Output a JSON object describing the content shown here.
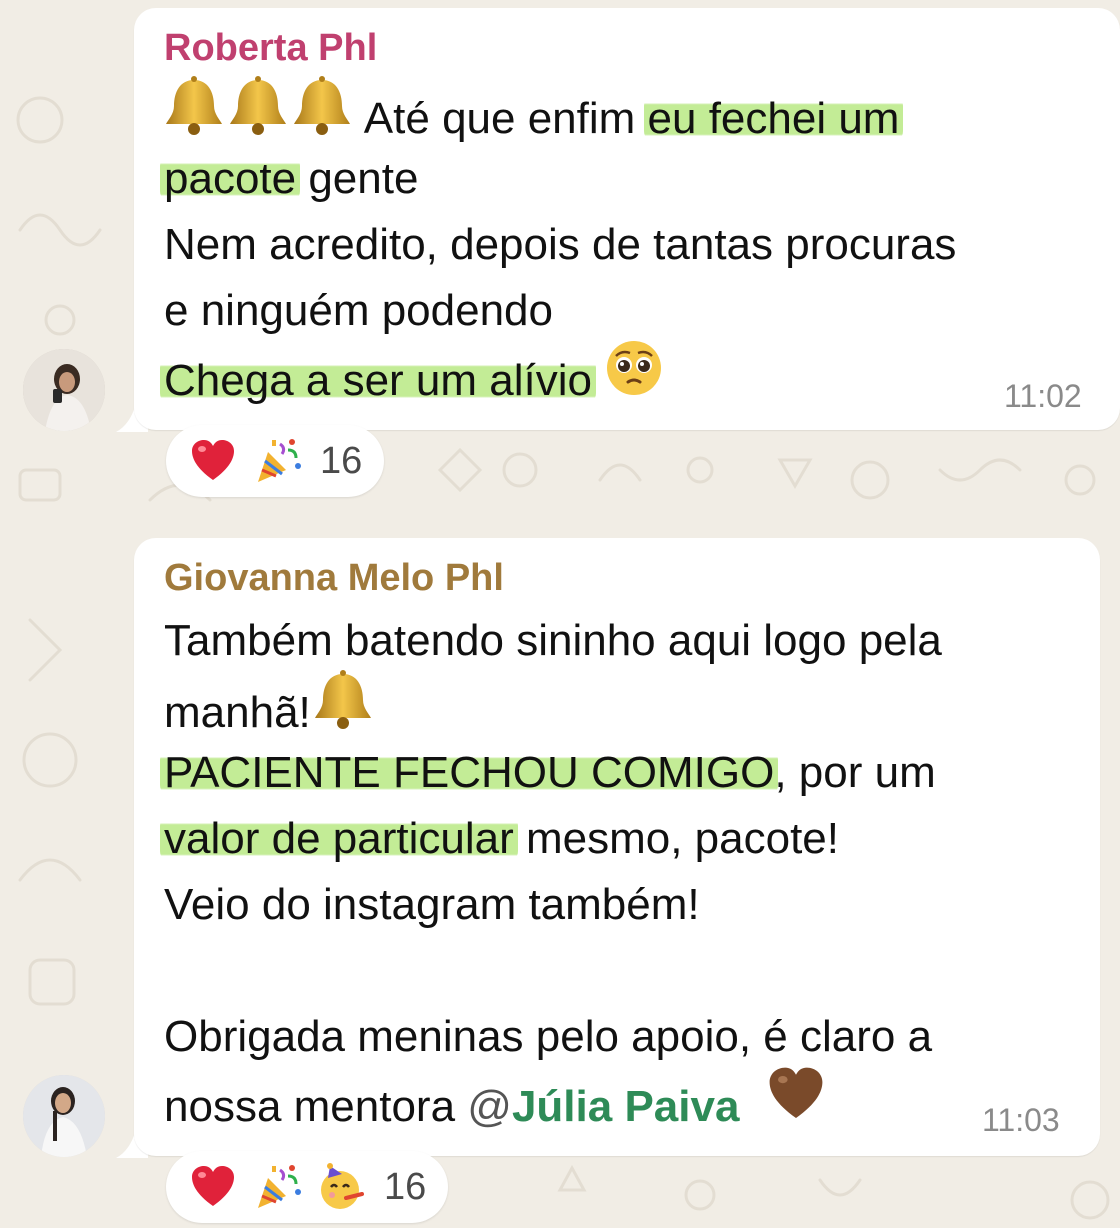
{
  "messages": [
    {
      "sender": "Roberta Phl",
      "sender_color": "#c0406f",
      "lines": [
        {
          "parts": [
            {
              "text": " Até que enfim "
            },
            {
              "text": "eu fechei um",
              "hl": true
            }
          ]
        },
        {
          "parts": [
            {
              "text": "pacote",
              "hl": true
            },
            {
              "text": " gente"
            }
          ]
        },
        {
          "parts": [
            {
              "text": "Nem acredito, depois de tantas procuras"
            }
          ]
        },
        {
          "parts": [
            {
              "text": "e ninguém podendo"
            }
          ]
        },
        {
          "parts": [
            {
              "text": "Chega a ser um alívio",
              "hl": true
            }
          ]
        }
      ],
      "time": "11:02",
      "reactions": {
        "icons": [
          "heart-icon",
          "party-popper-icon"
        ],
        "count": "16"
      }
    },
    {
      "sender": "Giovanna Melo Phl",
      "sender_color": "#a07a3c",
      "lines": [
        {
          "parts": [
            {
              "text": "Também batendo sininho aqui logo pela"
            }
          ]
        },
        {
          "parts": [
            {
              "text": "manhã!"
            }
          ]
        },
        {
          "parts": [
            {
              "text": "PACIENTE FECHOU COMIGO",
              "hl": true
            },
            {
              "text": ", por um"
            }
          ]
        },
        {
          "parts": [
            {
              "text": "valor de particular",
              "hl": true
            },
            {
              "text": " mesmo, pacote!"
            }
          ]
        },
        {
          "parts": [
            {
              "text": "Veio do instagram também!"
            }
          ]
        },
        {
          "parts": [
            {
              "text": "Obrigada meninas pelo apoio, é claro a"
            }
          ]
        },
        {
          "parts": [
            {
              "text": "nossa mentora "
            }
          ]
        }
      ],
      "mention": {
        "at": "@",
        "name": "Júlia Paiva"
      },
      "time": "11:03",
      "reactions": {
        "icons": [
          "heart-icon",
          "party-popper-icon",
          "partying-face-icon"
        ],
        "count": "16"
      }
    }
  ]
}
